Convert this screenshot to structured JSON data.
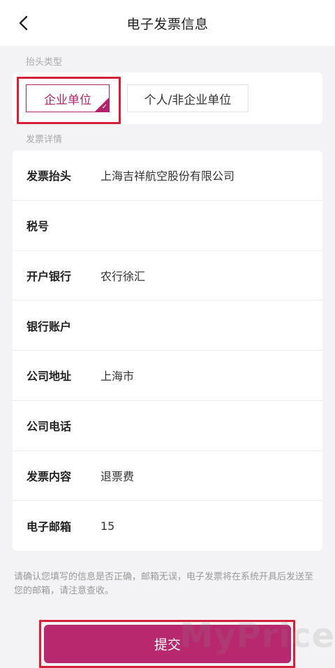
{
  "nav": {
    "title": "电子发票信息"
  },
  "header_type": {
    "label": "抬头类型",
    "options": [
      "企业单位",
      "个人/非企业单位"
    ],
    "selected": "企业单位"
  },
  "details": {
    "label": "发票详情",
    "rows": [
      {
        "label": "发票抬头",
        "value": "上海吉祥航空股份有限公司"
      },
      {
        "label": "税号",
        "value": ""
      },
      {
        "label": "开户银行",
        "value": "农行徐汇"
      },
      {
        "label": "银行账户",
        "value": ""
      },
      {
        "label": "公司地址",
        "value": "上海市"
      },
      {
        "label": "公司电话",
        "value": ""
      },
      {
        "label": "发票内容",
        "value": "退票费"
      },
      {
        "label": "电子邮箱",
        "value": "15"
      }
    ]
  },
  "notice": "请确认您填写的信息是否正确，邮箱无误，电子发票将在系统开具后发送至您的邮箱，请注意查收。",
  "submit_label": "提交",
  "watermark": "MyPrice",
  "colors": {
    "accent": "#b8286e",
    "highlight": "#d42038"
  }
}
